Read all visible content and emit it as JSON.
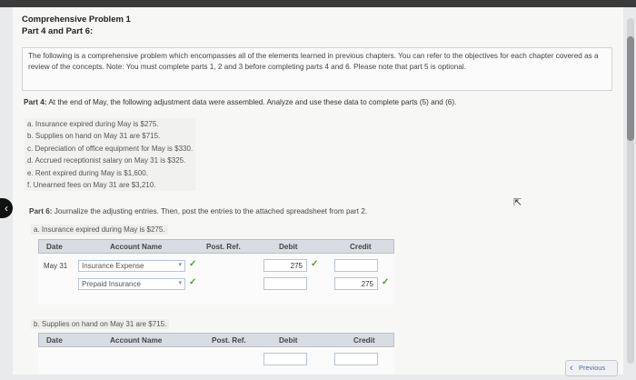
{
  "header": {
    "title": "Comprehensive Problem 1",
    "subtitle": "Part 4 and Part 6:"
  },
  "intro": "The following is a comprehensive problem which encompasses all of the elements learned in previous chapters. You can refer to the objectives for each chapter covered as a review of the concepts. Note: You must complete parts 1, 2 and 3 before completing parts 4 and 6. Please note that part 5 is optional.",
  "part4": {
    "label": "Part 4:",
    "text": "At the end of May, the following adjustment data were assembled. Analyze and use these data to complete parts (5) and (6)."
  },
  "adjustments": [
    "a. Insurance expired during May is $275.",
    "b. Supplies on hand on May 31 are $715.",
    "c. Depreciation of office equipment for May is $330.",
    "d. Accrued receptionist salary on May 31 is $325.",
    "e. Rent expired during May is $1,600.",
    "f. Unearned fees on May 31 are $3,210."
  ],
  "part6": {
    "label": "Part 6:",
    "text": "Journalize the adjusting entries. Then, post the entries to the attached spreadsheet from part 2."
  },
  "journal_a": {
    "question": "a. Insurance expired during May is $275.",
    "headers": {
      "date": "Date",
      "account": "Account Name",
      "post_ref": "Post. Ref.",
      "debit": "Debit",
      "credit": "Credit"
    },
    "row1": {
      "date": "May 31",
      "account": "Insurance Expense",
      "debit": "275",
      "credit": ""
    },
    "row2": {
      "account": "Prepaid Insurance",
      "debit": "",
      "credit": "275"
    }
  },
  "journal_b": {
    "question": "b. Supplies on hand on May 31 are $715.",
    "headers": {
      "date": "Date",
      "account": "Account Name",
      "post_ref": "Post. Ref.",
      "debit": "Debit",
      "credit": "Credit"
    }
  },
  "nav": {
    "previous": "Previous"
  },
  "colors": {
    "check": "#4c9a3a",
    "link": "#4b6ea8",
    "header_bg": "#d8dde3"
  }
}
